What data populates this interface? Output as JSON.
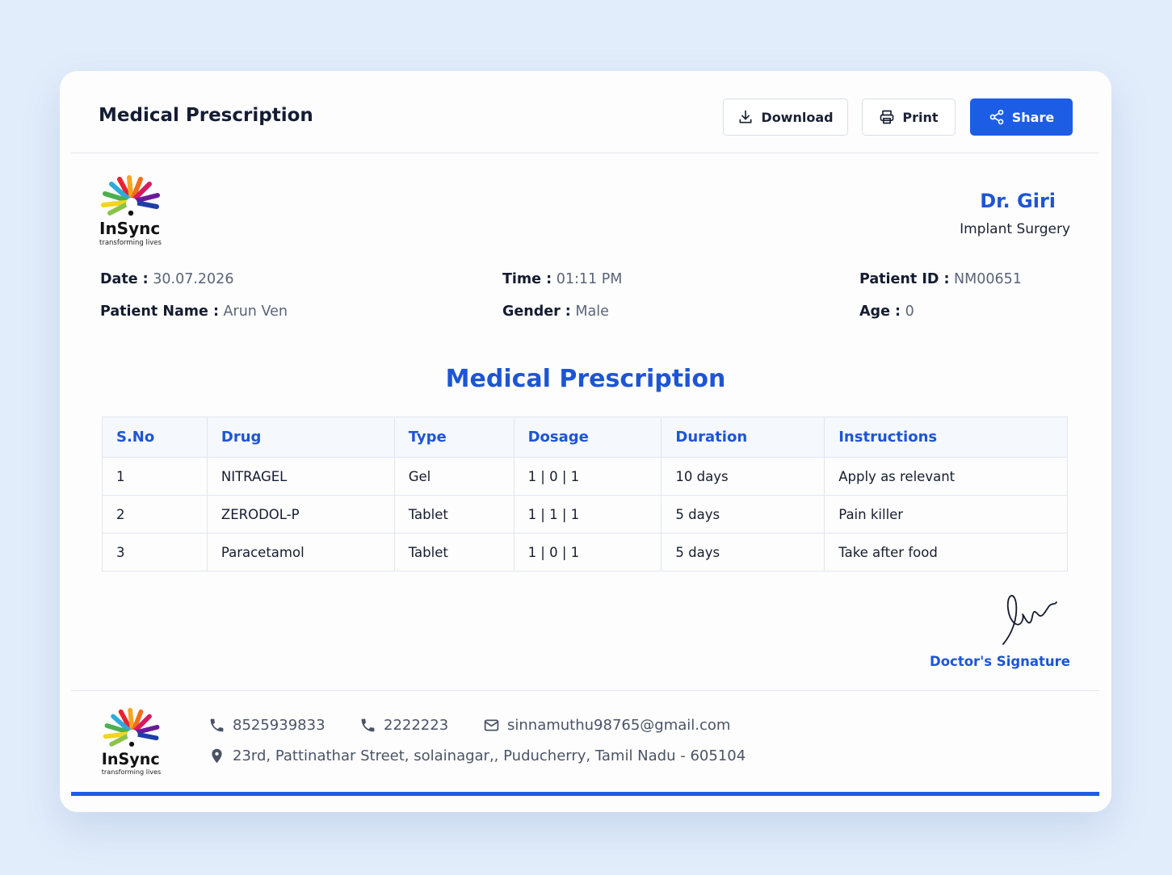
{
  "header": {
    "title": "Medical Prescription",
    "download_label": "Download",
    "print_label": "Print",
    "share_label": "Share"
  },
  "logo": {
    "name": "InSync",
    "tagline": "transforming lives"
  },
  "doctor": {
    "name": "Dr. Giri",
    "specialty": "Implant Surgery"
  },
  "patient": {
    "date_label": "Date :",
    "date": "30.07.2026",
    "time_label": "Time :",
    "time": "01:11 PM",
    "id_label": "Patient ID :",
    "id": "NM00651",
    "name_label": "Patient Name :",
    "name": "Arun Ven",
    "gender_label": "Gender :",
    "gender": "Male",
    "age_label": "Age :",
    "age": "0"
  },
  "prescription": {
    "title": "Medical Prescription",
    "columns": [
      "S.No",
      "Drug",
      "Type",
      "Dosage",
      "Duration",
      "Instructions"
    ],
    "rows": [
      [
        "1",
        "NITRAGEL",
        "Gel",
        "1 | 0 | 1",
        "10 days",
        "Apply as relevant"
      ],
      [
        "2",
        "ZERODOL-P",
        "Tablet",
        "1 | 1 | 1",
        "5 days",
        "Pain killer"
      ],
      [
        "3",
        "Paracetamol",
        "Tablet",
        "1 | 0 | 1",
        "5 days",
        "Take after food"
      ]
    ]
  },
  "signature": {
    "label": "Doctor's Signature"
  },
  "footer": {
    "phone1": "8525939833",
    "phone2": "2222223",
    "email": "sinnamuthu98765@gmail.com",
    "address": "23rd, Pattinathar Street, solainagar,, Puducherry, Tamil Nadu - 605104"
  },
  "colors": {
    "accent": "#1d55d4",
    "button_primary": "#1d5de6",
    "background": "#e2edfb"
  },
  "icons": [
    "download-icon",
    "printer-icon",
    "share-icon",
    "phone-icon",
    "mail-icon",
    "location-pin-icon"
  ]
}
